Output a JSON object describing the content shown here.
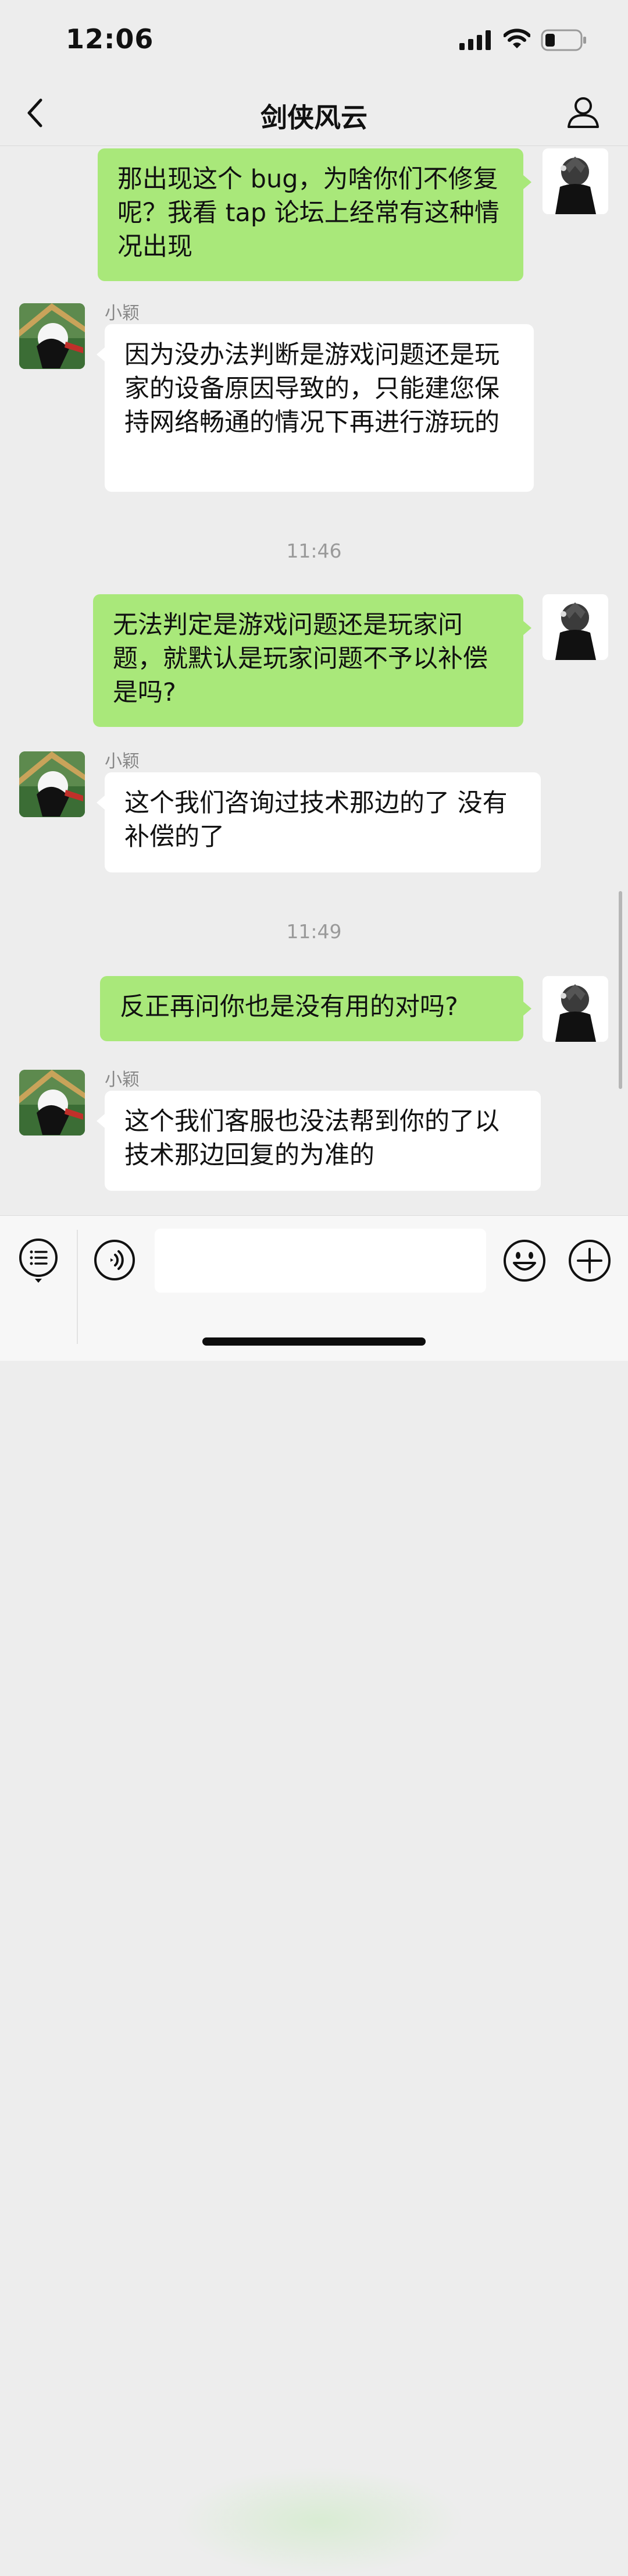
{
  "status_bar": {
    "time": "12:06",
    "icons": [
      "signal-icon",
      "wifi-icon",
      "battery-icon"
    ]
  },
  "header": {
    "title": "剑侠风云",
    "back_icon": "chevron-left-icon",
    "profile_icon": "person-icon"
  },
  "colors": {
    "self_bubble": "#a9e87a",
    "other_bubble": "#ffffff",
    "background": "#ededed"
  },
  "messages": [
    {
      "side": "self",
      "text": "那出现这个 bug，为啥你们不修复呢？我看 tap 论坛上经常有这种情况出现"
    },
    {
      "side": "other",
      "sender": "小颖",
      "text": "因为没办法判断是游戏问题还是玩家的设备原因导致的，只能建您保持网络畅通的情况下再进行游玩的"
    },
    {
      "time": "11:46"
    },
    {
      "side": "self",
      "text": "无法判定是游戏问题还是玩家问题，就默认是玩家问题不予以补偿是吗?"
    },
    {
      "side": "other",
      "sender": "小颖",
      "text": "这个我们咨询过技术那边的了 没有补偿的了"
    },
    {
      "time": "11:49"
    },
    {
      "side": "self",
      "text": "反正再问你也是没有用的对吗?"
    },
    {
      "side": "other",
      "sender": "小颖",
      "text": "这个我们客服也没法帮到你的了以技术那边回复的为准的"
    }
  ],
  "input_bar": {
    "value": "",
    "icons": [
      "menu-list-icon",
      "voice-icon",
      "emoji-icon",
      "plus-icon"
    ]
  }
}
